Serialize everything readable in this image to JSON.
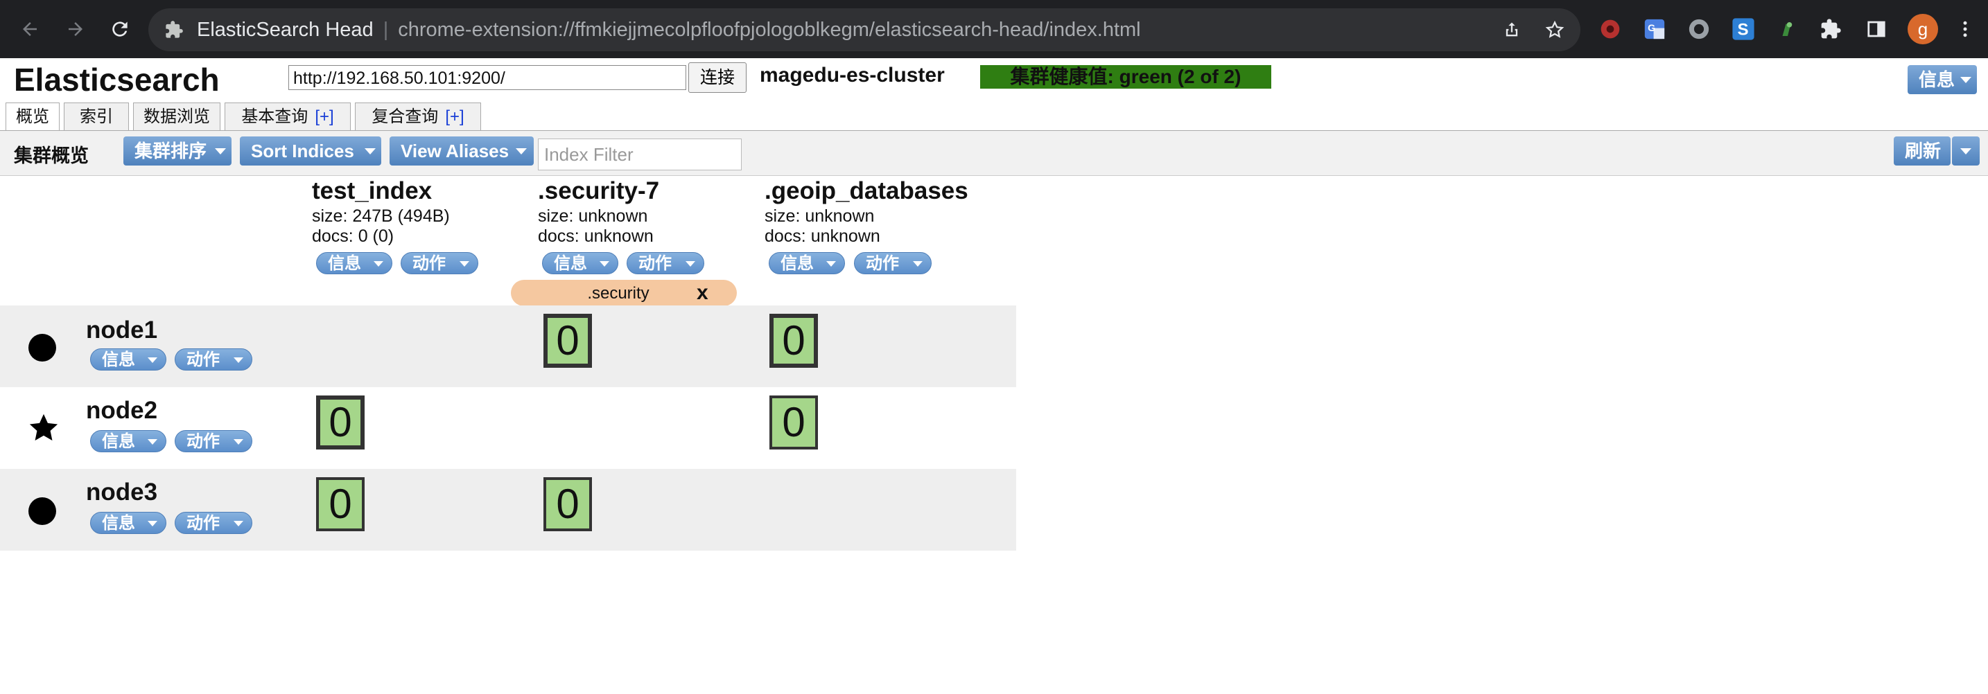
{
  "browser": {
    "tab_title": "ElasticSearch Head",
    "url": "chrome-extension://ffmkiejjmecolpfloofpjologoblkegm/elasticsearch-head/index.html",
    "profile_initial": "g",
    "icons": [
      "back-arrow-icon",
      "forward-arrow-icon",
      "reload-icon",
      "extension-icon",
      "share-icon",
      "bookmark-star-icon",
      "record-extension-icon",
      "translate-extension-icon",
      "circle-extension-icon",
      "s-extension-icon",
      "frog-extension-icon",
      "puzzle-extension-icon",
      "sidepanel-icon",
      "menu-kebab-icon"
    ]
  },
  "header": {
    "title": "Elasticsearch",
    "server_url": "http://192.168.50.101:9200/",
    "connect_label": "连接",
    "cluster_name": "magedu-es-cluster",
    "health": "集群健康值: green (2 of 2)",
    "health_color": "#2f7e12",
    "info_label": "信息"
  },
  "tabs": [
    {
      "label": "概览",
      "active": true
    },
    {
      "label": "索引"
    },
    {
      "label": "数据浏览"
    },
    {
      "label": "基本查询",
      "plus": "[+]"
    },
    {
      "label": "复合查询",
      "plus": "[+]"
    }
  ],
  "toolbar": {
    "title": "集群概览",
    "cluster_sort": "集群排序",
    "sort_indices": "Sort Indices",
    "view_aliases": "View Aliases",
    "index_filter_placeholder": "Index Filter",
    "refresh": "刷新"
  },
  "indices": [
    {
      "name": "test_index",
      "size": "size: 247B (494B)",
      "docs": "docs: 0 (0)",
      "info": "信息",
      "action": "动作"
    },
    {
      "name": ".security-7",
      "size": "size: unknown",
      "docs": "docs: unknown",
      "info": "信息",
      "action": "动作",
      "alias": ".security",
      "alias_close": "x"
    },
    {
      "name": ".geoip_databases",
      "size": "size: unknown",
      "docs": "docs: unknown",
      "info": "信息",
      "action": "动作"
    }
  ],
  "nodes": [
    {
      "name": "node1",
      "marker": "circle",
      "info": "信息",
      "action": "动作",
      "shards": [
        "",
        "0",
        "0"
      ]
    },
    {
      "name": "node2",
      "marker": "star",
      "info": "信息",
      "action": "动作",
      "shards": [
        "0",
        "",
        "0"
      ]
    },
    {
      "name": "node3",
      "marker": "circle",
      "info": "信息",
      "action": "动作",
      "shards": [
        "0",
        "0",
        ""
      ]
    }
  ],
  "colors": {
    "button_blue": "#5b8ecb",
    "shard_green": "#a5d68a",
    "alias_orange": "#f5c8a0",
    "row_shade": "#eeeeee"
  }
}
